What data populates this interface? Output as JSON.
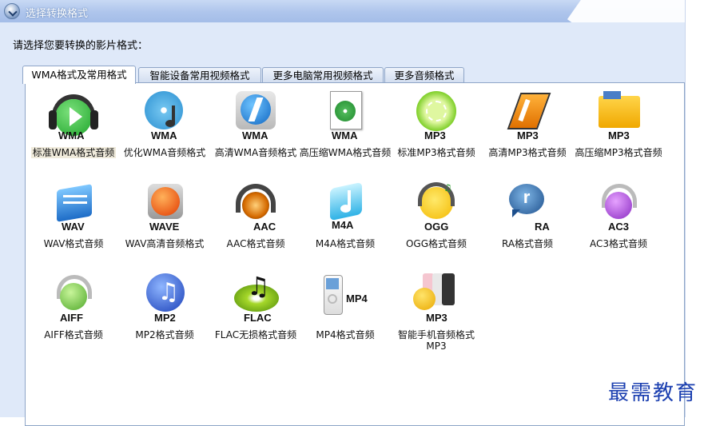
{
  "window": {
    "title": "选择转换格式",
    "prompt": "请选择您要转换的影片格式："
  },
  "tabs": [
    {
      "label": "WMA格式及常用格式",
      "active": true
    },
    {
      "label": "智能设备常用视频格式",
      "active": false
    },
    {
      "label": "更多电脑常用视频格式",
      "active": false
    },
    {
      "label": "更多音频格式",
      "active": false
    }
  ],
  "formats": [
    {
      "icon": "headphones-play-icon",
      "format": "WMA",
      "label": "标准WMA格式音频"
    },
    {
      "icon": "disc-note-icon",
      "format": "WMA",
      "label": "优化WMA音频格式"
    },
    {
      "icon": "lightning-icon",
      "format": "WMA",
      "label": "高清WMA音频格式"
    },
    {
      "icon": "document-disc-icon",
      "format": "WMA",
      "label": "高压缩WMA格式音频"
    },
    {
      "icon": "lime-icon",
      "format": "MP3",
      "label": "标准MP3格式音频"
    },
    {
      "icon": "winamp-icon",
      "format": "MP3",
      "label": "高清MP3格式音频"
    },
    {
      "icon": "folder-mp3-icon",
      "format": "MP3",
      "label": "高压缩MP3格式音频"
    },
    {
      "icon": "speaker-icon",
      "format": "WAV",
      "label": "WAV格式音频"
    },
    {
      "icon": "orange-wave-icon",
      "format": "WAVE",
      "label": "WAV高清音频格式"
    },
    {
      "icon": "disco-headphones-icon",
      "format": "AAC",
      "label": "AAC格式音频"
    },
    {
      "icon": "cyan-note-icon",
      "format": "M4A",
      "label": "M4A格式音频"
    },
    {
      "icon": "chick-headphones-icon",
      "format": "OGG",
      "label": "OGG格式音频"
    },
    {
      "icon": "real-audio-icon",
      "format": "RA",
      "label": "RA格式音频"
    },
    {
      "icon": "purple-headphones-icon",
      "format": "AC3",
      "label": "AC3格式音频"
    },
    {
      "icon": "green-headphones-icon",
      "format": "AIFF",
      "label": "AIFF格式音频"
    },
    {
      "icon": "blue-note-icon",
      "format": "MP2",
      "label": "MP2格式音频"
    },
    {
      "icon": "flac-disc-icon",
      "format": "FLAC",
      "label": "FLAC无损格式音频"
    },
    {
      "icon": "ipod-icon",
      "format": "MP4",
      "label": "MP4格式音频"
    },
    {
      "icon": "smartphones-icon",
      "format": "MP3",
      "label": "智能手机音频格式MP3"
    }
  ],
  "watermark": "最需教育"
}
